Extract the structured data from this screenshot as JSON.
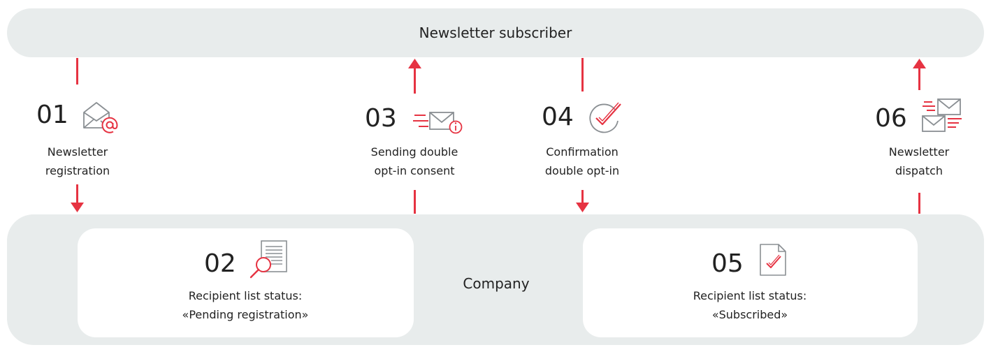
{
  "diagram": {
    "top_actor": "Newsletter subscriber",
    "bottom_actor": "Company",
    "steps": [
      {
        "number": "01",
        "icon": "envelope-at-icon",
        "label_line1": "Newsletter",
        "label_line2": "registration"
      },
      {
        "number": "02",
        "icon": "document-search-icon",
        "label_line1": "Recipient list status:",
        "label_line2": "«Pending registration»"
      },
      {
        "number": "03",
        "icon": "sending-envelope-info-icon",
        "label_line1": "Sending double",
        "label_line2": "opt-in consent"
      },
      {
        "number": "04",
        "icon": "checkmark-circle-icon",
        "label_line1": "Confirmation",
        "label_line2": "double opt-in"
      },
      {
        "number": "05",
        "icon": "document-check-icon",
        "label_line1": "Recipient list status:",
        "label_line2": "«Subscribed»"
      },
      {
        "number": "06",
        "icon": "multiple-envelopes-icon",
        "label_line1": "Newsletter",
        "label_line2": "dispatch"
      }
    ],
    "colors": {
      "accent": "#e63342",
      "panel": "#e8ecec",
      "card": "#ffffff",
      "text": "#222222",
      "icon_gray": "#8a8f93"
    }
  }
}
